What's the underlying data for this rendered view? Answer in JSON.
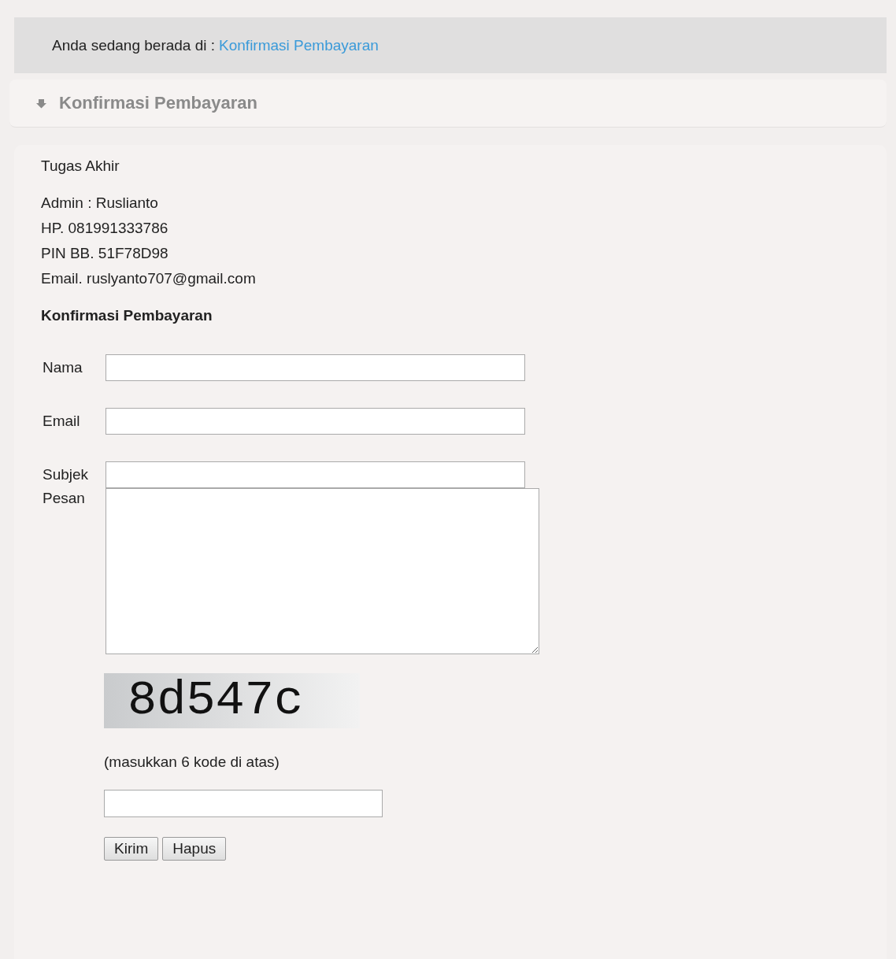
{
  "breadcrumb": {
    "prefix": "Anda sedang berada di :",
    "link": "Konfirmasi Pembayaran"
  },
  "heading": "Konfirmasi Pembayaran",
  "intro": "Tugas Akhir",
  "contact": [
    "Admin : Ruslianto",
    "HP. 081991333786",
    "PIN BB. 51F78D98",
    "Email. ruslyanto707@gmail.com"
  ],
  "form_title": "Konfirmasi Pembayaran",
  "fields": [
    {
      "label": "Nama",
      "kind": "text"
    },
    {
      "label": "Email",
      "kind": "text"
    },
    {
      "label": "Subjek",
      "kind": "text"
    },
    {
      "label": "Pesan",
      "kind": "textarea"
    }
  ],
  "captcha": {
    "code": "8d547c",
    "hint": "(masukkan 6 kode di atas)"
  },
  "buttons": [
    "Kirim",
    "Hapus"
  ]
}
